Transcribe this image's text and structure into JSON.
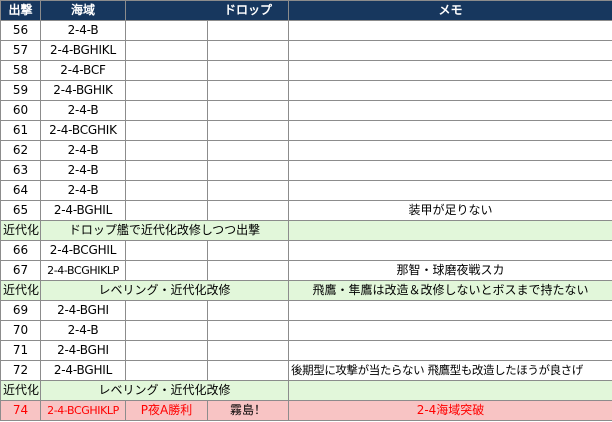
{
  "headers": {
    "sortie": "出撃",
    "area": "海域",
    "drop": "ドロップ",
    "memo": "メモ"
  },
  "rows": [
    {
      "num": "56",
      "area": "2-4-B"
    },
    {
      "num": "57",
      "area": "2-4-BGHIKL"
    },
    {
      "num": "58",
      "area": "2-4-BCF"
    },
    {
      "num": "59",
      "area": "2-4-BGHIK"
    },
    {
      "num": "60",
      "area": "2-4-B"
    },
    {
      "num": "61",
      "area": "2-4-BCGHIK"
    },
    {
      "num": "62",
      "area": "2-4-B"
    },
    {
      "num": "63",
      "area": "2-4-B"
    },
    {
      "num": "64",
      "area": "2-4-B"
    },
    {
      "num": "65",
      "area": "2-4-BGHIL",
      "memo": "装甲が足りない"
    },
    {
      "label": "近代化",
      "text": "ドロップ艦で近代化改修しつつ出撃"
    },
    {
      "num": "66",
      "area": "2-4-BCGHIL"
    },
    {
      "num": "67",
      "area": "2-4-BCGHIKLP",
      "memo": "那智・球磨夜戦スカ"
    },
    {
      "label": "近代化",
      "text": "レベリング・近代化改修",
      "memo": "飛鷹・隼鷹は改造＆改修しないとボスまで持たない"
    },
    {
      "num": "69",
      "area": "2-4-BGHI"
    },
    {
      "num": "70",
      "area": "2-4-B"
    },
    {
      "num": "71",
      "area": "2-4-BGHI"
    },
    {
      "num": "72",
      "area": "2-4-BGHIL",
      "memo": "後期型に攻撃が当たらない 飛鷹型も改造したほうが良さげ"
    },
    {
      "label": "近代化",
      "text": "レベリング・近代化改修"
    },
    {
      "num": "74",
      "area": "2-4-BCGHIKLP",
      "drop_a": "P夜A勝利",
      "drop_b": "霧島！",
      "memo": "2-4海域突破"
    }
  ]
}
